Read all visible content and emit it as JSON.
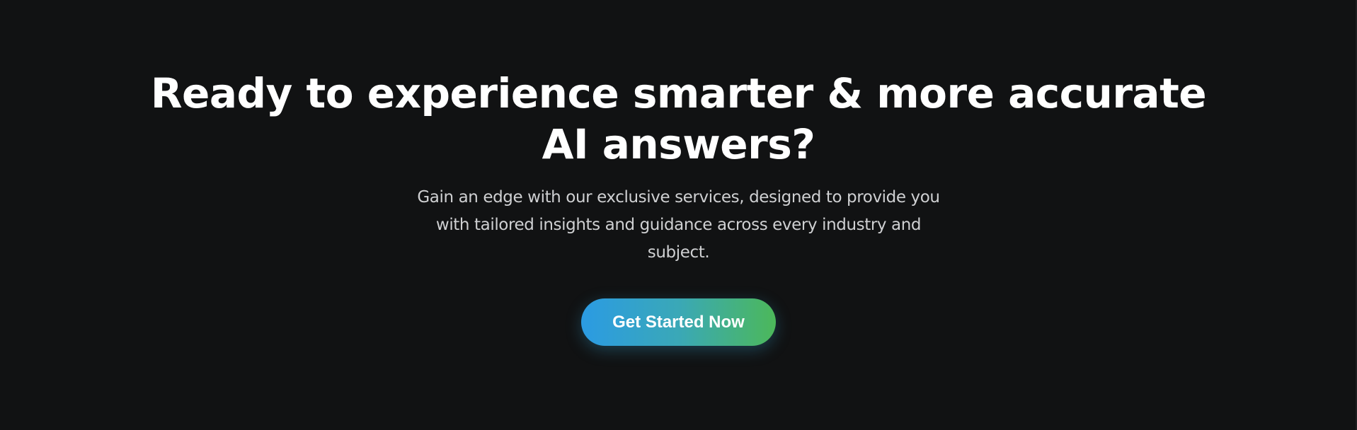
{
  "cta": {
    "title": "Ready to experience smarter & more accurate AI answers?",
    "subtitle": "Gain an edge with our exclusive services, designed to provide you with tailored insights and guidance across every industry and subject.",
    "button_label": "Get Started Now"
  },
  "colors": {
    "background": "#111213",
    "title": "#ffffff",
    "subtitle": "#cfd0d2",
    "button_gradient_start": "#2b9be3",
    "button_gradient_end": "#4cb85a"
  }
}
